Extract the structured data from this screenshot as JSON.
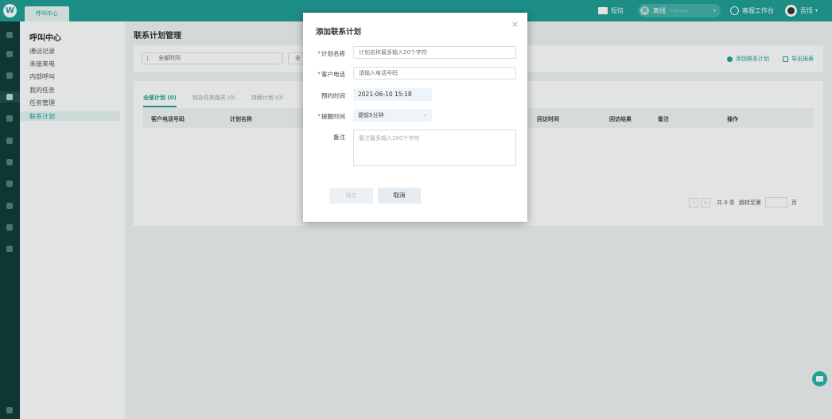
{
  "topbar": {
    "logo_glyph": "W",
    "tab_label": "呼叫中心",
    "sms_label": "短信",
    "status_avatar": "离",
    "status_label": "离线",
    "status_time": "--:--:--",
    "status_caret": "▾",
    "workbench_label": "客服工作台",
    "user_name": "吾悟",
    "user_caret": "▾"
  },
  "subnav": {
    "title": "呼叫中心",
    "items": [
      {
        "label": "通话记录"
      },
      {
        "label": "未接来电"
      },
      {
        "label": "内部呼叫"
      },
      {
        "label": "我的任务"
      },
      {
        "label": "任务管理"
      },
      {
        "label": "联系计划"
      }
    ]
  },
  "main": {
    "page_title": "联系计划管理",
    "filter": {
      "date_range": "全部时间",
      "date_sep": "›",
      "second_select": "全"
    },
    "actions": {
      "add_plan": "添加联系计划",
      "export_report": "导出报表"
    },
    "tabs": [
      {
        "label": "全部计划 (0)"
      },
      {
        "label": "待办任务相关 (0)"
      },
      {
        "label": "持续计划 (0)"
      }
    ],
    "columns": [
      "客户电话号码",
      "计划名称",
      "回访时间",
      "回访结果",
      "备注",
      "操作"
    ],
    "pager": {
      "prev": "‹",
      "next": "›",
      "total": "共 0 条",
      "jump": "跳转至第",
      "page_unit": "页"
    }
  },
  "modal": {
    "title": "添加联系计划",
    "close_glyph": "×",
    "fields": {
      "plan_name": {
        "label": "计划名称",
        "placeholder": "计划名称最多输入20个字符"
      },
      "phone": {
        "label": "客户电话",
        "placeholder": "请输入电话号码"
      },
      "appointment": {
        "label": "预约时间",
        "value": "2021-06-10 15:18"
      },
      "reminder": {
        "label": "提醒时间",
        "value": "提前5分钟",
        "caret": "⌄"
      },
      "remark": {
        "label": "备注",
        "placeholder": "备注最多输入200个字符"
      }
    },
    "required_mark": "*",
    "confirm_label": "确定",
    "cancel_label": "取消"
  },
  "colors": {
    "brand": "#1f9e93",
    "required": "#e54d42"
  }
}
